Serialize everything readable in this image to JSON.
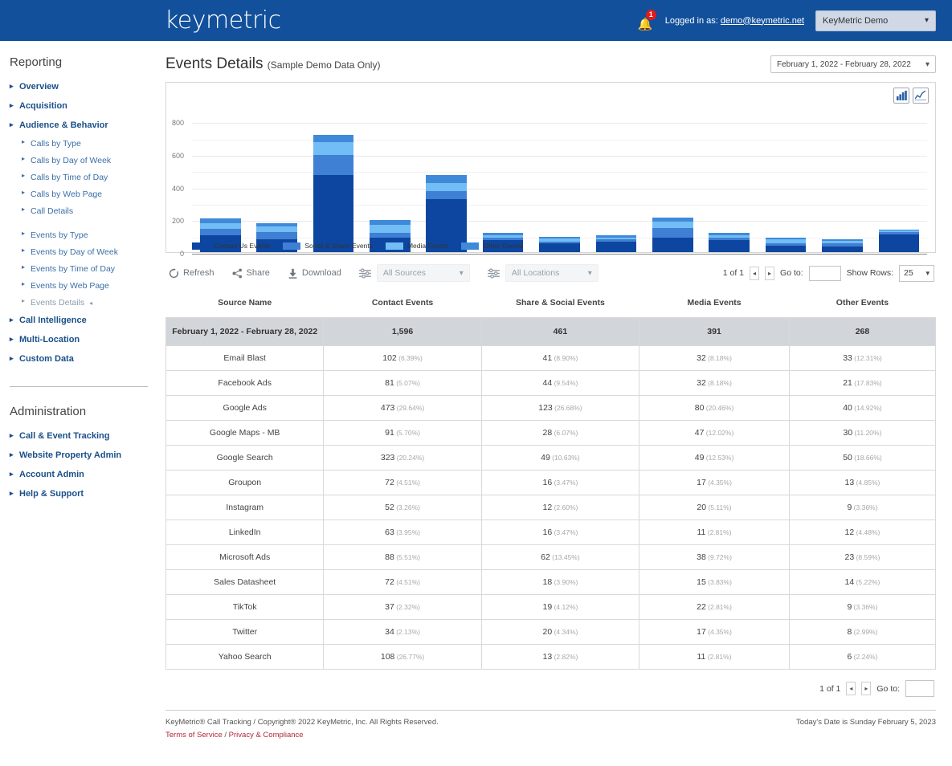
{
  "topbar": {
    "logo": "keymetric",
    "bell_icon": "bell-icon",
    "notification_count": "1",
    "logged_in_label": "Logged in as:",
    "logged_in_email": "demo@keymetric.net",
    "account_selected": "KeyMetric Demo",
    "chevron": "⌄",
    "brand_color": "#12509b"
  },
  "sidebar": {
    "reporting_title": "Reporting",
    "reporting_items": [
      {
        "label": "Overview",
        "type": "top"
      },
      {
        "label": "Acquisition",
        "type": "top"
      },
      {
        "label": "Audience & Behavior",
        "type": "top"
      },
      {
        "label": "Calls by Type",
        "type": "sub"
      },
      {
        "label": "Calls by Day of Week",
        "type": "sub"
      },
      {
        "label": "Calls by Time of Day",
        "type": "sub"
      },
      {
        "label": "Calls by Web Page",
        "type": "sub"
      },
      {
        "label": "Call Details",
        "type": "sub"
      },
      {
        "label": "Events by Type",
        "type": "sub"
      },
      {
        "label": "Events by Day of Week",
        "type": "sub"
      },
      {
        "label": "Events by Time of Day",
        "type": "sub"
      },
      {
        "label": "Events by Web Page",
        "type": "sub"
      },
      {
        "label": "Events Details",
        "type": "sub-active"
      },
      {
        "label": "Call Intelligence",
        "type": "top"
      },
      {
        "label": "Multi-Location",
        "type": "top"
      },
      {
        "label": "Custom Data",
        "type": "top"
      }
    ],
    "admin_title": "Administration",
    "admin_items": [
      {
        "label": "Call & Event Tracking"
      },
      {
        "label": "Website Property Admin"
      },
      {
        "label": "Account Admin"
      },
      {
        "label": "Help & Support"
      }
    ]
  },
  "page": {
    "title": "Events Details",
    "subtitle": "(Sample Demo Data Only)",
    "date_range": "February 1, 2022 - February 28, 2022"
  },
  "chart_controls": {
    "bar_icon": "bar-chart-icon",
    "line_icon": "line-chart-icon"
  },
  "toolbar": {
    "refresh_label": "Refresh",
    "share_label": "Share",
    "download_label": "Download",
    "sources_value": "All Sources",
    "locations_value": "All Locations",
    "page_of": "1  of  1",
    "prev_arrow": "◂",
    "next_arrow": "▸",
    "goto_label": "Go to:",
    "goto_value": "",
    "show_rows_label": "Show Rows:",
    "show_rows_value": "25"
  },
  "table": {
    "columns": [
      "Source Name",
      "Contact Events",
      "Share & Social Events",
      "Media Events",
      "Other Events"
    ],
    "summary": {
      "label": "February 1, 2022 - February 28, 2022",
      "contact": "1,596",
      "share": "461",
      "media": "391",
      "other": "268"
    },
    "rows": [
      {
        "source": "Email Blast",
        "contact": "102",
        "contact_pct": "(6.39%)",
        "share": "41",
        "share_pct": "(8.90%)",
        "media": "32",
        "media_pct": "(8.18%)",
        "other": "33",
        "other_pct": "(12.31%)"
      },
      {
        "source": "Facebook Ads",
        "contact": "81",
        "contact_pct": "(5.07%)",
        "share": "44",
        "share_pct": "(9.54%)",
        "media": "32",
        "media_pct": "(8.18%)",
        "other": "21",
        "other_pct": "(17.83%)"
      },
      {
        "source": "Google Ads",
        "contact": "473",
        "contact_pct": "(29.64%)",
        "share": "123",
        "share_pct": "(26.68%)",
        "media": "80",
        "media_pct": "(20.46%)",
        "other": "40",
        "other_pct": "(14.92%)"
      },
      {
        "source": "Google Maps - MB",
        "contact": "91",
        "contact_pct": "(5.70%)",
        "share": "28",
        "share_pct": "(6.07%)",
        "media": "47",
        "media_pct": "(12.02%)",
        "other": "30",
        "other_pct": "(11.20%)"
      },
      {
        "source": "Google Search",
        "contact": "323",
        "contact_pct": "(20.24%)",
        "share": "49",
        "share_pct": "(10.63%)",
        "media": "49",
        "media_pct": "(12.53%)",
        "other": "50",
        "other_pct": "(18.66%)"
      },
      {
        "source": "Groupon",
        "contact": "72",
        "contact_pct": "(4.51%)",
        "share": "16",
        "share_pct": "(3.47%)",
        "media": "17",
        "media_pct": "(4.35%)",
        "other": "13",
        "other_pct": "(4.85%)"
      },
      {
        "source": "Instagram",
        "contact": "52",
        "contact_pct": "(3.26%)",
        "share": "12",
        "share_pct": "(2.60%)",
        "media": "20",
        "media_pct": "(5.11%)",
        "other": "9",
        "other_pct": "(3.36%)"
      },
      {
        "source": "LinkedIn",
        "contact": "63",
        "contact_pct": "(3.95%)",
        "share": "16",
        "share_pct": "(3.47%)",
        "media": "11",
        "media_pct": "(2.81%)",
        "other": "12",
        "other_pct": "(4.48%)"
      },
      {
        "source": "Microsoft Ads",
        "contact": "88",
        "contact_pct": "(5.51%)",
        "share": "62",
        "share_pct": "(13.45%)",
        "media": "38",
        "media_pct": "(9.72%)",
        "other": "23",
        "other_pct": "(8.59%)"
      },
      {
        "source": "Sales Datasheet",
        "contact": "72",
        "contact_pct": "(4.51%)",
        "share": "18",
        "share_pct": "(3.90%)",
        "media": "15",
        "media_pct": "(3.83%)",
        "other": "14",
        "other_pct": "(5.22%)"
      },
      {
        "source": "TikTok",
        "contact": "37",
        "contact_pct": "(2.32%)",
        "share": "19",
        "share_pct": "(4.12%)",
        "media": "22",
        "media_pct": "(2.81%)",
        "other": "9",
        "other_pct": "(3.36%)"
      },
      {
        "source": "Twitter",
        "contact": "34",
        "contact_pct": "(2.13%)",
        "share": "20",
        "share_pct": "(4.34%)",
        "media": "17",
        "media_pct": "(4.35%)",
        "other": "8",
        "other_pct": "(2.99%)"
      },
      {
        "source": "Yahoo Search",
        "contact": "108",
        "contact_pct": "(26.77%)",
        "share": "13",
        "share_pct": "(2.82%)",
        "media": "11",
        "media_pct": "(2.81%)",
        "other": "6",
        "other_pct": "(2.24%)"
      }
    ]
  },
  "bottom_pager": {
    "page_of": "1  of  1",
    "prev_arrow": "◂",
    "next_arrow": "▸",
    "goto_label": "Go to:",
    "goto_value": ""
  },
  "footer": {
    "copyright": "KeyMetric® Call Tracking / Copyright® 2022 KeyMetric, Inc. All Rights Reserved.",
    "terms": "Terms of Service",
    "separator": " / ",
    "privacy": "Privacy & Compliance",
    "today": "Today's Date is Sunday February 5, 2023"
  },
  "chart_data": {
    "type": "bar",
    "stacked": true,
    "title": "",
    "xlabel": "",
    "ylabel": "",
    "ylim": [
      0,
      900
    ],
    "yticks": [
      0,
      200,
      400,
      600,
      800
    ],
    "grid": true,
    "legend_position": "bottom-left",
    "categories": [
      "Email Blast",
      "Facebook Ads",
      "Google Ads",
      "Google Maps - MB",
      "Google Search",
      "Groupon",
      "Instagram",
      "LinkedIn",
      "Microsoft Ads",
      "Sales Datasheet",
      "TikTok",
      "Twitter",
      "Yahoo Search"
    ],
    "series": [
      {
        "name": "Contact Us Events",
        "color": "#0d46a0",
        "values": [
          102,
          81,
          473,
          91,
          323,
          72,
          52,
          63,
          88,
          72,
          37,
          34,
          108
        ]
      },
      {
        "name": "Social & Share Events",
        "color": "#3f7fd4",
        "values": [
          41,
          44,
          123,
          28,
          49,
          16,
          12,
          16,
          62,
          18,
          19,
          20,
          13
        ]
      },
      {
        "name": "Media Events",
        "color": "#72bdf5",
        "values": [
          32,
          32,
          80,
          47,
          49,
          17,
          20,
          11,
          38,
          15,
          22,
          17,
          11
        ]
      },
      {
        "name": "Other Events",
        "color": "#3f8ad8",
        "values": [
          33,
          21,
          40,
          30,
          50,
          13,
          9,
          12,
          23,
          14,
          9,
          8,
          6
        ]
      }
    ]
  }
}
